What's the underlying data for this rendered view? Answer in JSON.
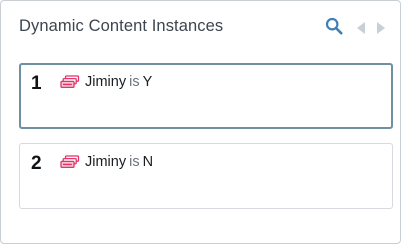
{
  "panel": {
    "title": "Dynamic Content Instances",
    "icons": [
      "search-icon",
      "prev-icon",
      "next-icon"
    ]
  },
  "instances": [
    {
      "number": "1",
      "field": "Jiminy",
      "operator": "is",
      "value": "Y",
      "selected": true
    },
    {
      "number": "2",
      "field": "Jiminy",
      "operator": "is",
      "value": "N",
      "selected": false
    }
  ],
  "colors": {
    "title": "#3c4550",
    "search": "#3f7fb5",
    "nav_disabled": "#c9cfd6",
    "condition_icon": "#e2336b",
    "selected_border": "#6f8fa3"
  }
}
